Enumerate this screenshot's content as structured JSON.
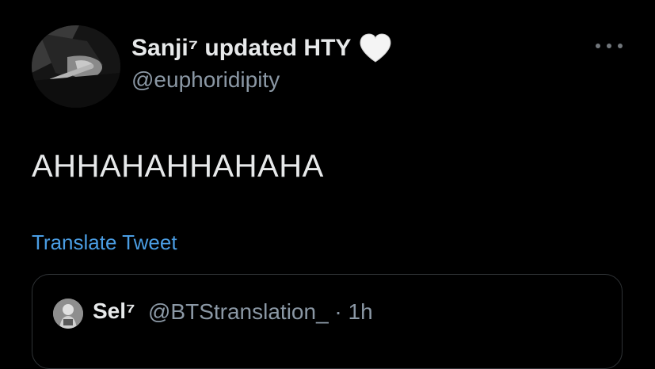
{
  "tweet": {
    "author": {
      "display_name": "Sanji⁷ updated HTY",
      "name_emoji": "white-heart-icon",
      "handle": "@euphoridipity"
    },
    "text": "AHHAHAHHAHAHA",
    "translate_label": "Translate Tweet",
    "more_icon": "more-options-icon"
  },
  "quoted_tweet": {
    "display_name": "Sel⁷",
    "handle_and_time": "@BTStranslation_ · 1h"
  },
  "colors": {
    "background": "#000000",
    "primary_text": "#e7e9ea",
    "secondary_text": "#8b98a5",
    "link": "#4a9de3",
    "border": "#2f3336"
  }
}
